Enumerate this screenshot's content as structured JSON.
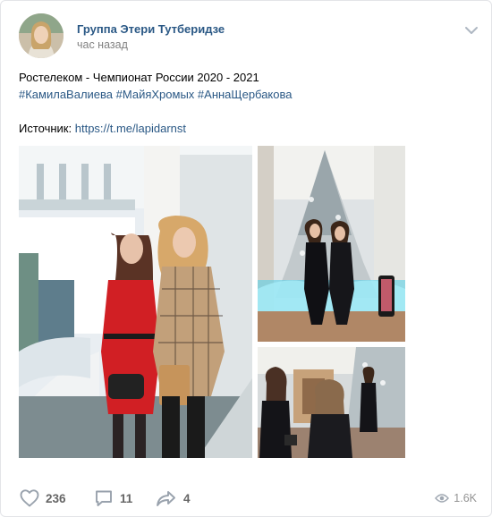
{
  "post": {
    "author": "Группа Этери Тутберидзе",
    "time": "час назад",
    "title_line": "Ростелеком - Чемпионат России 2020 - 2021",
    "hashtags": [
      "#КамилаВалиева",
      "#МайяХромых",
      "#АннаЩербакова"
    ],
    "source_label": "Источник:",
    "source_link": "https://t.me/lapidarnst"
  },
  "footer": {
    "likes": "236",
    "comments": "11",
    "shares": "4",
    "views": "1.6K"
  },
  "icons": {
    "like": "heart-icon",
    "comment": "comment-icon",
    "share": "share-arrow-icon",
    "views": "eye-icon",
    "more": "chevron-down-icon"
  },
  "colors": {
    "link": "#2a5885",
    "secondary_text": "#828282",
    "icon": "#99a2ad"
  }
}
